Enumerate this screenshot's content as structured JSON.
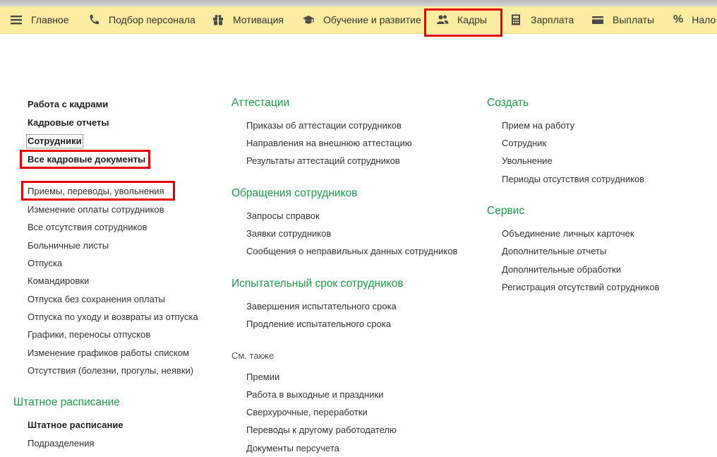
{
  "toolbar": {
    "items": [
      {
        "label": "Главное",
        "icon": "menu-icon"
      },
      {
        "label": "Подбор персонала",
        "icon": "phone-icon"
      },
      {
        "label": "Мотивация",
        "icon": "gift-icon"
      },
      {
        "label": "Обучение и развитие",
        "icon": "graduation-cap-icon"
      },
      {
        "label": "Кадры",
        "icon": "users-icon"
      },
      {
        "label": "Зарплата",
        "icon": "calculator-icon"
      },
      {
        "label": "Выплаты",
        "icon": "wallet-icon"
      },
      {
        "label": "Нало",
        "icon": "percent-icon"
      }
    ],
    "active": "Кадры",
    "accent_color": "#fbeca0",
    "highlight_color": "#e30000"
  },
  "col1": {
    "top_links": [
      "Работа с кадрами",
      "Кадровые отчеты",
      "Сотрудники",
      "Все кадровые документы"
    ],
    "doc_links": [
      "Приемы, переводы, увольнения",
      "Изменение оплаты сотрудников",
      "Все отсутствия сотрудников",
      "Больничные листы",
      "Отпуска",
      "Командировки",
      "Отпуска без сохранения оплаты",
      "Отпуска по уходу и возвраты из отпуска",
      "Графики, переносы отпусков",
      "Изменение графиков работы списком",
      "Отсутствия (болезни, прогулы, неявки)"
    ],
    "staffing_heading": "Штатное расписание",
    "staffing_links": [
      "Штатное расписание",
      "Подразделения"
    ]
  },
  "col2": {
    "attest_heading": "Аттестации",
    "attest_links": [
      "Приказы об аттестации сотрудников",
      "Направления на внешнюю аттестацию",
      "Результаты аттестаций сотрудников"
    ],
    "requests_heading": "Обращения сотрудников",
    "requests_links": [
      "Запросы справок",
      "Заявки сотрудников",
      "Сообщения о неправильных данных сотрудников"
    ],
    "probation_heading": "Испытательный срок сотрудников",
    "probation_links": [
      "Завершения испытательного срока",
      "Продление испытательного срока"
    ],
    "see_also": "См. также",
    "see_also_links": [
      "Премии",
      "Работа в выходные и праздники",
      "Сверхурочные, переработки",
      "Переводы к другому работодателю",
      "Документы персучета"
    ]
  },
  "col3": {
    "create_heading": "Создать",
    "create_links": [
      "Прием на работу",
      "Сотрудник",
      "Увольнение",
      "Периоды отсутствия сотрудников"
    ],
    "service_heading": "Сервис",
    "service_links": [
      "Объединение личных карточек",
      "Дополнительные отчеты",
      "Дополнительные обработки",
      "Регистрация отсутствий сотрудников"
    ]
  }
}
